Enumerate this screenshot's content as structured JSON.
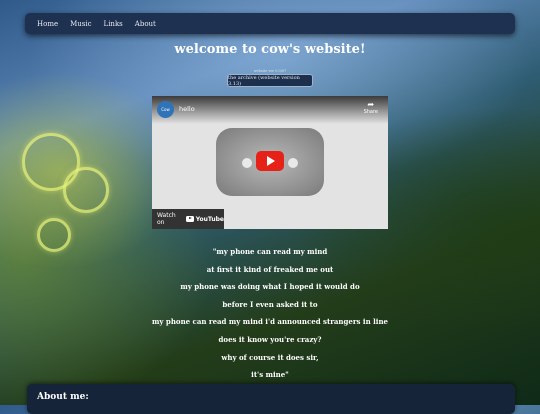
{
  "nav": {
    "items": [
      {
        "label": "Home"
      },
      {
        "label": "Music"
      },
      {
        "label": "Links"
      },
      {
        "label": "About"
      }
    ]
  },
  "header": {
    "title": "welcome to cow's website!",
    "version_small": "website ver 0.0/07",
    "archive_button": "the archive (website version 3.13)"
  },
  "video": {
    "title": "hello",
    "channel_avatar_text": "Cow",
    "share_label": "Share",
    "watch_on_label": "Watch on",
    "youtube_brand": "YouTube"
  },
  "lyrics": [
    "\"my phone can read my mind",
    "at first it kind of freaked me out",
    "my phone was doing what I hoped it would do",
    "before I even asked it to",
    "my phone can read my mind i'd announced strangers in line",
    "does it know you're crazy?",
    "why of course it does sir,",
    "it's mine\""
  ],
  "about": {
    "heading": "About me:"
  },
  "colors": {
    "navbar": "#1e3150",
    "play_button": "#e62117",
    "panel": "#16243a"
  }
}
